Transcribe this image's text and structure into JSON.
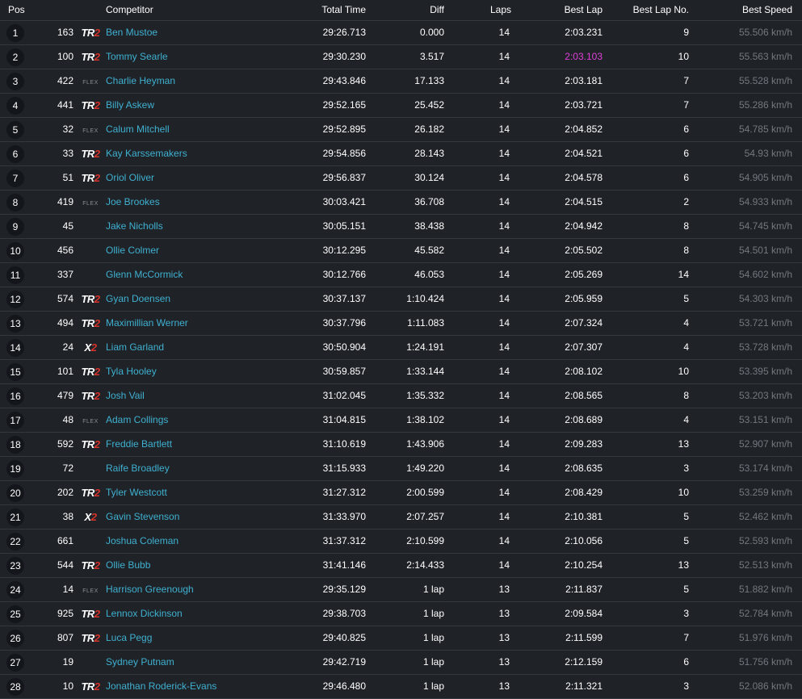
{
  "colors": {
    "background": "#1f2328",
    "name_link": "#3fb0d0",
    "fastest_lap": "#e03fd8",
    "speed_text": "#73787e",
    "class_accent": "#d8332b",
    "row_divider": "#34393f"
  },
  "table": {
    "headers": {
      "pos": "Pos",
      "competitor": "Competitor",
      "total_time": "Total Time",
      "diff": "Diff",
      "laps": "Laps",
      "best_lap": "Best Lap",
      "best_lap_no": "Best Lap No.",
      "best_speed": "Best Speed"
    },
    "rows": [
      {
        "pos": "1",
        "no": "163",
        "cls": "TR2",
        "name": "Ben Mustoe",
        "total": "29:26.713",
        "diff": "0.000",
        "laps": "14",
        "best": "2:03.231",
        "bestno": "9",
        "speed": "55.506 km/h",
        "fastest": false
      },
      {
        "pos": "2",
        "no": "100",
        "cls": "TR2",
        "name": "Tommy Searle",
        "total": "29:30.230",
        "diff": "3.517",
        "laps": "14",
        "best": "2:03.103",
        "bestno": "10",
        "speed": "55.563 km/h",
        "fastest": true
      },
      {
        "pos": "3",
        "no": "422",
        "cls": "FLEX",
        "name": "Charlie Heyman",
        "total": "29:43.846",
        "diff": "17.133",
        "laps": "14",
        "best": "2:03.181",
        "bestno": "7",
        "speed": "55.528 km/h",
        "fastest": false
      },
      {
        "pos": "4",
        "no": "441",
        "cls": "TR2",
        "name": "Billy Askew",
        "total": "29:52.165",
        "diff": "25.452",
        "laps": "14",
        "best": "2:03.721",
        "bestno": "7",
        "speed": "55.286 km/h",
        "fastest": false
      },
      {
        "pos": "5",
        "no": "32",
        "cls": "FLEX",
        "name": "Calum Mitchell",
        "total": "29:52.895",
        "diff": "26.182",
        "laps": "14",
        "best": "2:04.852",
        "bestno": "6",
        "speed": "54.785 km/h",
        "fastest": false
      },
      {
        "pos": "6",
        "no": "33",
        "cls": "TR2",
        "name": "Kay Karssemakers",
        "total": "29:54.856",
        "diff": "28.143",
        "laps": "14",
        "best": "2:04.521",
        "bestno": "6",
        "speed": "54.93 km/h",
        "fastest": false
      },
      {
        "pos": "7",
        "no": "51",
        "cls": "TR2",
        "name": "Oriol Oliver",
        "total": "29:56.837",
        "diff": "30.124",
        "laps": "14",
        "best": "2:04.578",
        "bestno": "6",
        "speed": "54.905 km/h",
        "fastest": false
      },
      {
        "pos": "8",
        "no": "419",
        "cls": "FLEX",
        "name": "Joe Brookes",
        "total": "30:03.421",
        "diff": "36.708",
        "laps": "14",
        "best": "2:04.515",
        "bestno": "2",
        "speed": "54.933 km/h",
        "fastest": false
      },
      {
        "pos": "9",
        "no": "45",
        "cls": "",
        "name": "Jake Nicholls",
        "total": "30:05.151",
        "diff": "38.438",
        "laps": "14",
        "best": "2:04.942",
        "bestno": "8",
        "speed": "54.745 km/h",
        "fastest": false
      },
      {
        "pos": "10",
        "no": "456",
        "cls": "",
        "name": "Ollie Colmer",
        "total": "30:12.295",
        "diff": "45.582",
        "laps": "14",
        "best": "2:05.502",
        "bestno": "8",
        "speed": "54.501 km/h",
        "fastest": false
      },
      {
        "pos": "11",
        "no": "337",
        "cls": "",
        "name": "Glenn McCormick",
        "total": "30:12.766",
        "diff": "46.053",
        "laps": "14",
        "best": "2:05.269",
        "bestno": "14",
        "speed": "54.602 km/h",
        "fastest": false
      },
      {
        "pos": "12",
        "no": "574",
        "cls": "TR2",
        "name": "Gyan Doensen",
        "total": "30:37.137",
        "diff": "1:10.424",
        "laps": "14",
        "best": "2:05.959",
        "bestno": "5",
        "speed": "54.303 km/h",
        "fastest": false
      },
      {
        "pos": "13",
        "no": "494",
        "cls": "TR2",
        "name": "Maximillian Werner",
        "total": "30:37.796",
        "diff": "1:11.083",
        "laps": "14",
        "best": "2:07.324",
        "bestno": "4",
        "speed": "53.721 km/h",
        "fastest": false
      },
      {
        "pos": "14",
        "no": "24",
        "cls": "X2",
        "name": "Liam Garland",
        "total": "30:50.904",
        "diff": "1:24.191",
        "laps": "14",
        "best": "2:07.307",
        "bestno": "4",
        "speed": "53.728 km/h",
        "fastest": false
      },
      {
        "pos": "15",
        "no": "101",
        "cls": "TR2",
        "name": "Tyla Hooley",
        "total": "30:59.857",
        "diff": "1:33.144",
        "laps": "14",
        "best": "2:08.102",
        "bestno": "10",
        "speed": "53.395 km/h",
        "fastest": false
      },
      {
        "pos": "16",
        "no": "479",
        "cls": "TR2",
        "name": "Josh Vail",
        "total": "31:02.045",
        "diff": "1:35.332",
        "laps": "14",
        "best": "2:08.565",
        "bestno": "8",
        "speed": "53.203 km/h",
        "fastest": false
      },
      {
        "pos": "17",
        "no": "48",
        "cls": "FLEX",
        "name": "Adam Collings",
        "total": "31:04.815",
        "diff": "1:38.102",
        "laps": "14",
        "best": "2:08.689",
        "bestno": "4",
        "speed": "53.151 km/h",
        "fastest": false
      },
      {
        "pos": "18",
        "no": "592",
        "cls": "TR2",
        "name": "Freddie Bartlett",
        "total": "31:10.619",
        "diff": "1:43.906",
        "laps": "14",
        "best": "2:09.283",
        "bestno": "13",
        "speed": "52.907 km/h",
        "fastest": false
      },
      {
        "pos": "19",
        "no": "72",
        "cls": "",
        "name": "Raife Broadley",
        "total": "31:15.933",
        "diff": "1:49.220",
        "laps": "14",
        "best": "2:08.635",
        "bestno": "3",
        "speed": "53.174 km/h",
        "fastest": false
      },
      {
        "pos": "20",
        "no": "202",
        "cls": "TR2",
        "name": "Tyler Westcott",
        "total": "31:27.312",
        "diff": "2:00.599",
        "laps": "14",
        "best": "2:08.429",
        "bestno": "10",
        "speed": "53.259 km/h",
        "fastest": false
      },
      {
        "pos": "21",
        "no": "38",
        "cls": "X2",
        "name": "Gavin Stevenson",
        "total": "31:33.970",
        "diff": "2:07.257",
        "laps": "14",
        "best": "2:10.381",
        "bestno": "5",
        "speed": "52.462 km/h",
        "fastest": false
      },
      {
        "pos": "22",
        "no": "661",
        "cls": "",
        "name": "Joshua Coleman",
        "total": "31:37.312",
        "diff": "2:10.599",
        "laps": "14",
        "best": "2:10.056",
        "bestno": "5",
        "speed": "52.593 km/h",
        "fastest": false
      },
      {
        "pos": "23",
        "no": "544",
        "cls": "TR2",
        "name": "Ollie Bubb",
        "total": "31:41.146",
        "diff": "2:14.433",
        "laps": "14",
        "best": "2:10.254",
        "bestno": "13",
        "speed": "52.513 km/h",
        "fastest": false
      },
      {
        "pos": "24",
        "no": "14",
        "cls": "FLEX",
        "name": "Harrison Greenough",
        "total": "29:35.129",
        "diff": "1 lap",
        "laps": "13",
        "best": "2:11.837",
        "bestno": "5",
        "speed": "51.882 km/h",
        "fastest": false
      },
      {
        "pos": "25",
        "no": "925",
        "cls": "TR2",
        "name": "Lennox Dickinson",
        "total": "29:38.703",
        "diff": "1 lap",
        "laps": "13",
        "best": "2:09.584",
        "bestno": "3",
        "speed": "52.784 km/h",
        "fastest": false
      },
      {
        "pos": "26",
        "no": "807",
        "cls": "TR2",
        "name": "Luca Pegg",
        "total": "29:40.825",
        "diff": "1 lap",
        "laps": "13",
        "best": "2:11.599",
        "bestno": "7",
        "speed": "51.976 km/h",
        "fastest": false
      },
      {
        "pos": "27",
        "no": "19",
        "cls": "",
        "name": "Sydney Putnam",
        "total": "29:42.719",
        "diff": "1 lap",
        "laps": "13",
        "best": "2:12.159",
        "bestno": "6",
        "speed": "51.756 km/h",
        "fastest": false
      },
      {
        "pos": "28",
        "no": "10",
        "cls": "TR2",
        "name": "Jonathan Roderick-Evans",
        "total": "29:46.480",
        "diff": "1 lap",
        "laps": "13",
        "best": "2:11.321",
        "bestno": "3",
        "speed": "52.086 km/h",
        "fastest": false
      }
    ]
  }
}
